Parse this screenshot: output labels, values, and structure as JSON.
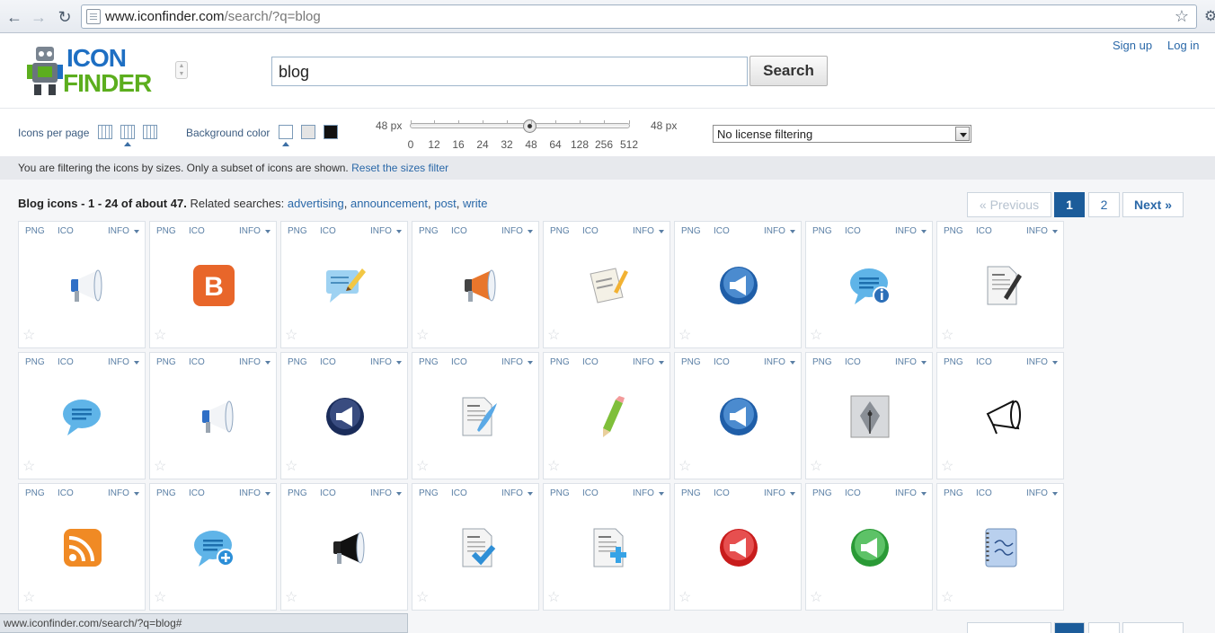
{
  "browser": {
    "url_domain": "www.iconfinder.com",
    "url_path": "/search/?q=blog",
    "back_icon": "back-arrow-icon",
    "forward_icon": "forward-arrow-icon",
    "reload_icon": "reload-icon"
  },
  "header": {
    "logo_top": "ICON",
    "logo_bottom": "FINDER",
    "search_value": "blog",
    "search_button": "Search",
    "sign_up": "Sign up",
    "log_in": "Log in"
  },
  "filters": {
    "icons_per_page_label": "Icons per page",
    "background_color_label": "Background color",
    "size_min_label": "48 px",
    "size_max_label": "48 px",
    "size_ticks": [
      "0",
      "12",
      "16",
      "24",
      "32",
      "48",
      "64",
      "128",
      "256",
      "512"
    ],
    "selected_size": "48",
    "license_value": "No license filtering"
  },
  "notice": {
    "text": "You are filtering the icons by sizes. Only a subset of icons are shown.",
    "reset_link": "Reset the sizes filter"
  },
  "results": {
    "title": "Blog icons",
    "range": "- 1 - 24 of about 47.",
    "related_label": "Related searches:",
    "related": [
      "advertising",
      "announcement",
      "post",
      "write"
    ],
    "pager": {
      "previous": "« Previous",
      "page1": "1",
      "page2": "2",
      "next": "Next »"
    },
    "card_labels": {
      "png": "PNG",
      "ico": "ICO",
      "info": "INFO"
    },
    "icons": [
      "megaphone-white-icon",
      "blogger-logo-icon",
      "chat-pencil-icon",
      "megaphone-orange-icon",
      "document-pencil-icon",
      "megaphone-blue-round-icon",
      "chat-info-icon",
      "blog-document-pen-icon",
      "chat-bubble-blue-icon",
      "megaphone-white-icon",
      "megaphone-dark-round-icon",
      "blog-document-quill-icon",
      "pencil-green-icon",
      "megaphone-blue-round-icon",
      "fountain-pen-nib-icon",
      "megaphone-sketch-icon",
      "rss-feed-icon",
      "chat-add-icon",
      "megaphone-black-icon",
      "blog-document-check-icon",
      "blog-document-add-icon",
      "megaphone-red-round-icon",
      "megaphone-green-round-icon",
      "dear-diary-notebook-icon"
    ]
  },
  "status_bar": {
    "text": "www.iconfinder.com/search/?q=blog#"
  }
}
